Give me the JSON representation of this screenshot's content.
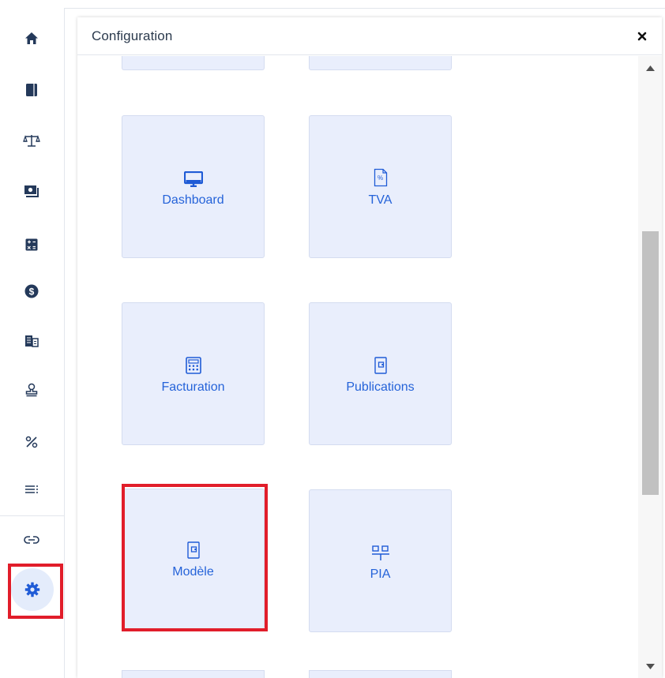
{
  "rail": {
    "items": [
      {
        "icon": "home-icon"
      },
      {
        "icon": "book-icon"
      },
      {
        "icon": "balance-scale-icon"
      },
      {
        "icon": "money-bill-icon"
      },
      {
        "icon": "calculator-icon"
      },
      {
        "icon": "dollar-circle-icon"
      },
      {
        "icon": "building-icon"
      },
      {
        "icon": "stamp-icon"
      },
      {
        "icon": "percent-icon"
      },
      {
        "icon": "list-icon"
      },
      {
        "icon": "link-icon"
      },
      {
        "icon": "gear-icon",
        "active": true
      }
    ]
  },
  "panel": {
    "title": "Configuration",
    "close_label": "×"
  },
  "tiles": [
    {
      "label": "Dashboard",
      "icon": "monitor-icon"
    },
    {
      "label": "TVA",
      "icon": "percent-document-icon"
    },
    {
      "label": "Facturation",
      "icon": "calculator-icon"
    },
    {
      "label": "Publications",
      "icon": "document-icon"
    },
    {
      "label": "Modèle",
      "icon": "document-icon",
      "highlighted": true
    },
    {
      "label": "PIA",
      "icon": "org-chart-icon"
    }
  ],
  "colors": {
    "accent": "#1f5bd6",
    "tile_bg": "#e9eefc",
    "highlight": "#e11d2a",
    "rail_icon": "#24395a"
  }
}
